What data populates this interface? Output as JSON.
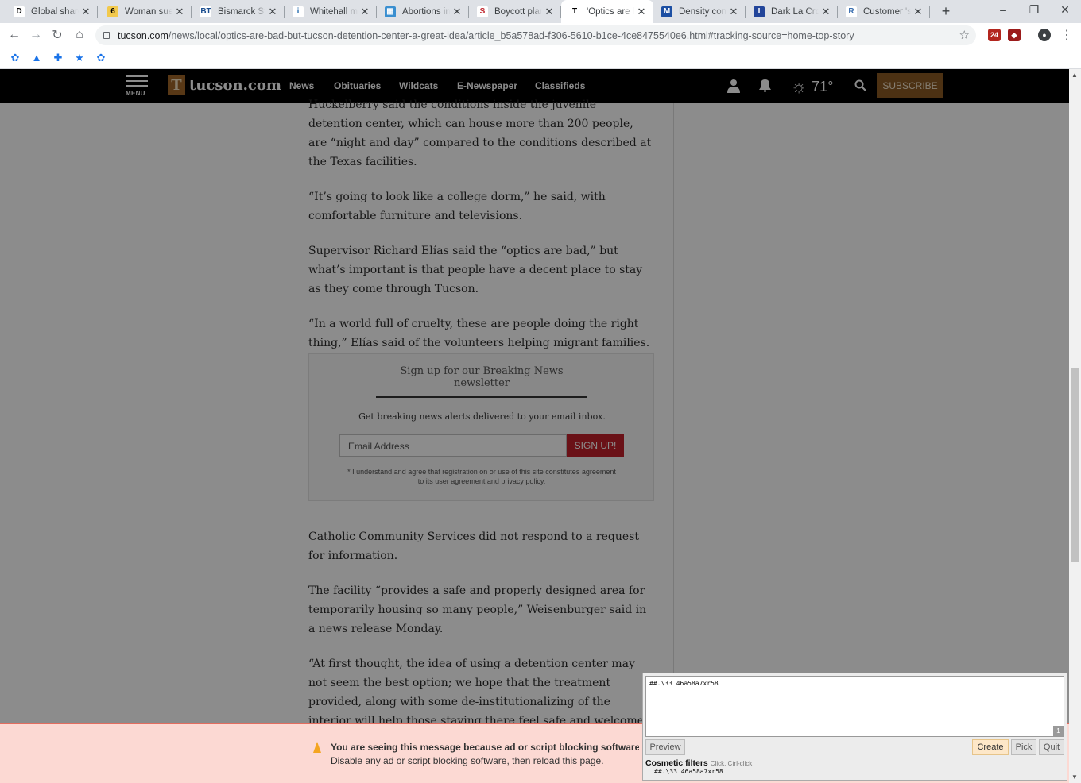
{
  "browser": {
    "tabs": [
      {
        "title": "Global shares",
        "favicon": "D",
        "favicon_bg": "#ffffff",
        "favicon_fg": "#000000"
      },
      {
        "title": "Woman sues",
        "favicon": "6",
        "favicon_bg": "#f2c94c",
        "favicon_fg": "#000000"
      },
      {
        "title": "Bismarck State",
        "favicon": "BT",
        "favicon_bg": "#ffffff",
        "favicon_fg": "#1a4d8f"
      },
      {
        "title": "Whitehall man",
        "favicon": "i",
        "favicon_bg": "#ffffff",
        "favicon_fg": "#2a6fb0"
      },
      {
        "title": "Abortions in S",
        "favicon": "▦",
        "favicon_bg": "#3a8fd0",
        "favicon_fg": "#ffffff"
      },
      {
        "title": "Boycott plann",
        "favicon": "S",
        "favicon_bg": "#ffffff",
        "favicon_fg": "#c0262d"
      },
      {
        "title": "'Optics are ba",
        "favicon": "T",
        "favicon_bg": "#ffffff",
        "favicon_fg": "#000000"
      },
      {
        "title": "Density conce",
        "favicon": "M",
        "favicon_bg": "#1c4fa3",
        "favicon_fg": "#ffffff"
      },
      {
        "title": "Dark La Cross",
        "favicon": "I",
        "favicon_bg": "#22459a",
        "favicon_fg": "#ffffff"
      },
      {
        "title": "Customer 'sh",
        "favicon": "R",
        "favicon_bg": "#ffffff",
        "favicon_fg": "#3b6fb0"
      }
    ],
    "new_tab": "+",
    "window_controls": [
      "‒",
      "❐",
      "✕"
    ],
    "url_host": "tucson.com",
    "url_path": "/news/local/optics-are-bad-but-tucson-detention-center-a-great-idea/article_b5a578ad-f306-5610-b1ce-4ce8475540e6.html#tracking-source=home-top-story",
    "extension_badge": "24",
    "bookmark_icons": [
      "gear-icon",
      "flask-icon",
      "puzzle-icon",
      "star-icon",
      "gear-icon"
    ]
  },
  "site": {
    "menu_label": "MENU",
    "logo_letter": "T",
    "logo_text": "tucson.com",
    "nav": [
      "News",
      "Obituaries",
      "Wildcats",
      "E-Newspaper",
      "Classifieds"
    ],
    "temperature": "71°",
    "subscribe_label": "SUBSCRIBE"
  },
  "article": {
    "paragraphs_top": [
      "Huckelberry said the conditions inside the juvenile detention center, which can house more than 200 people, are “night and day” compared to the conditions described at the Texas facilities.",
      "“It’s going to look like a college dorm,” he said, with comfortable furniture and televisions.",
      "Supervisor Richard Elías said the “optics are bad,” but what’s important is that people have a decent place to stay as they come through Tucson.",
      "“In a world full of cruelty, these are people doing the right thing,” Elías said of the volunteers helping migrant families."
    ],
    "paragraphs_bottom": [
      "Catholic Community Services did not respond to a request for information.",
      "The facility “provides a safe and properly designed area for temporarily housing so many people,” Weisenburger said in a news release Monday.",
      "“At first thought, the idea of using a detention center may not seem the best option; we hope that the treatment provided, along with some de-institutionalizing of the interior will help those staying there feel safe and welcome,” Weisenburger said."
    ]
  },
  "newsletter": {
    "title": "Sign up for our Breaking News newsletter",
    "description": "Get breaking news alerts delivered to your email inbox.",
    "email_placeholder": "Email Address",
    "button_label": "SIGN UP!",
    "legal": "* I understand and agree that registration on or use of this site constitutes agreement to its user agreement and privacy policy."
  },
  "adblock_notice": {
    "line1": "You are seeing this message because ad or script blocking software i",
    "line2": "Disable any ad or script blocking software, then reload this page."
  },
  "picker": {
    "filter_text": "##.\\33 46a58a7xr58",
    "match_count": "1",
    "preview_label": "Preview",
    "create_label": "Create",
    "pick_label": "Pick",
    "quit_label": "Quit",
    "cosmetic_title": "Cosmetic filters",
    "cosmetic_hint": "Click, Ctrl-click",
    "cosmetic_item": "##.\\33 46a58a7xr58"
  }
}
